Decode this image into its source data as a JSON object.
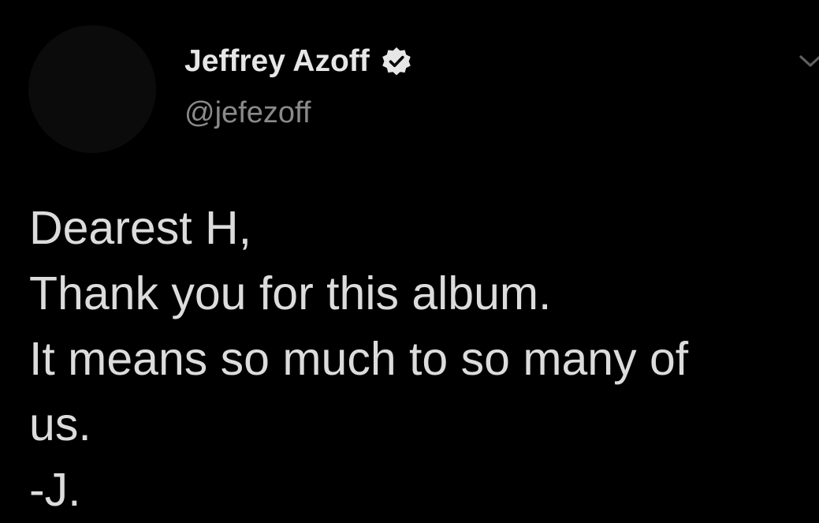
{
  "tweet": {
    "author": {
      "display_name": "Jeffrey Azoff",
      "handle": "@jefezoff",
      "verified": true,
      "avatar_icon": "avatar-placeholder"
    },
    "menu_icon": "chevron-down-icon",
    "text_lines": [
      "Dearest H,",
      "Thank you for this album.",
      "It means so much to so many of",
      "us.",
      "-J."
    ]
  },
  "colors": {
    "background": "#000000",
    "name": "#e6e6e6",
    "handle": "#8a8a8a",
    "body_text": "#dcdcdc",
    "avatar": "#0b0b0b",
    "verified_badge": "#e6e6e6"
  }
}
